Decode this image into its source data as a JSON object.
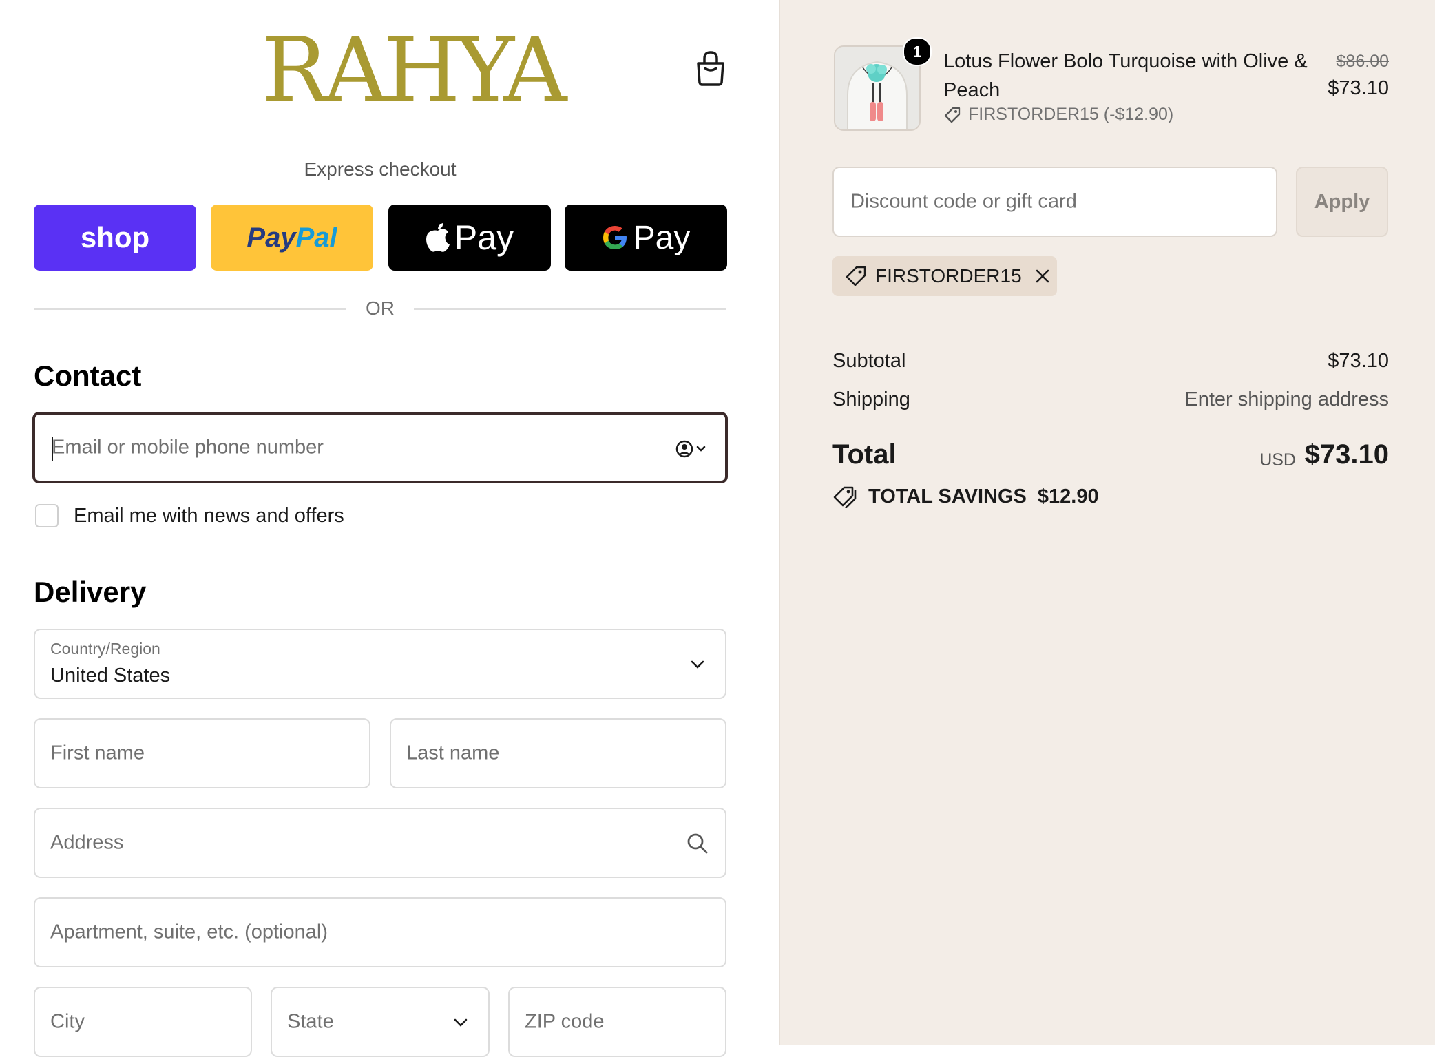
{
  "brand": {
    "logo_text": "RAHYA"
  },
  "express": {
    "title": "Express checkout",
    "shop": "shop",
    "paypal_a": "Pay",
    "paypal_b": "Pal",
    "apple": "Pay",
    "google": "Pay"
  },
  "divider": "OR",
  "contact": {
    "title": "Contact",
    "email_placeholder": "Email or mobile phone number",
    "newsletter_label": "Email me with news and offers"
  },
  "delivery": {
    "title": "Delivery",
    "country_label": "Country/Region",
    "country_value": "United States",
    "first_name": "First name",
    "last_name": "Last name",
    "address": "Address",
    "apartment": "Apartment, suite, etc. (optional)",
    "city": "City",
    "state": "State",
    "zip": "ZIP code"
  },
  "summary": {
    "product": {
      "quantity": "1",
      "name": "Lotus Flower Bolo Turquoise with Olive & Peach",
      "discount_line": "FIRSTORDER15 (-$12.90)",
      "original_price": "$86.00",
      "price": "$73.10"
    },
    "discount_placeholder": "Discount code or gift card",
    "apply_label": "Apply",
    "applied_code": "FIRSTORDER15",
    "subtotal_label": "Subtotal",
    "subtotal_value": "$73.10",
    "shipping_label": "Shipping",
    "shipping_value": "Enter shipping address",
    "total_label": "Total",
    "currency": "USD",
    "total_value": "$73.10",
    "savings_label": "TOTAL SAVINGS",
    "savings_value": "$12.90"
  },
  "colors": {
    "brand_gold": "#a99a32",
    "shop_purple": "#5a31f4",
    "paypal_yellow": "#ffc439",
    "summary_bg": "#f3ede7"
  }
}
